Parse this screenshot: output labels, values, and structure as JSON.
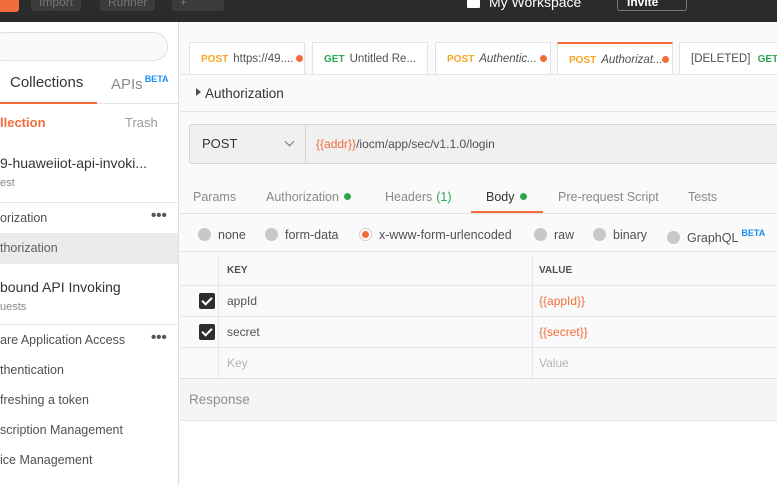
{
  "topbar": {
    "import_label": "Import",
    "runner_label": "Runner",
    "new_tab_label": "+",
    "workspace_label": "My Workspace",
    "invite_label": "Invite"
  },
  "sidebar": {
    "tabs": {
      "collections": "Collections",
      "apis": "APIs",
      "apis_badge": "BETA"
    },
    "new_collection_label": "llection",
    "trash_label": "Trash",
    "collections": [
      {
        "title": "9-huaweiiot-api-invoki...",
        "subtitle": "est"
      },
      {
        "title": "bound API Invoking",
        "subtitle": "uests"
      }
    ],
    "items": [
      {
        "label": "orization",
        "has_menu": true,
        "active": false
      },
      {
        "label": "thorization",
        "has_menu": false,
        "active": true
      },
      {
        "label": "are Application Access",
        "has_menu": true,
        "active": false
      },
      {
        "label": "thentication",
        "has_menu": false,
        "active": false
      },
      {
        "label": "freshing a token",
        "has_menu": false,
        "active": false
      },
      {
        "label": "scription Management",
        "has_menu": false,
        "active": false
      },
      {
        "label": "ice Management",
        "has_menu": false,
        "active": false
      }
    ]
  },
  "request_tabs": [
    {
      "method": "POST",
      "name": "https://49....",
      "unsaved": true,
      "active": false
    },
    {
      "method": "GET",
      "name": "Untitled Re...",
      "unsaved": false,
      "active": false
    },
    {
      "method": "POST",
      "name": "Authentic...",
      "unsaved": true,
      "active": false
    },
    {
      "method": "POST",
      "name": "Authorizat...",
      "unsaved": true,
      "active": true
    },
    {
      "method": "[DELETED]",
      "name": "GET",
      "unsaved": false,
      "active": false,
      "close": "×"
    }
  ],
  "request": {
    "title": "Authorization",
    "method": "POST",
    "url_var": "{{addr}}",
    "url_path": "/iocm/app/sec/v1.1.0/login"
  },
  "subtabs": {
    "params": "Params",
    "authorization": "Authorization",
    "headers": "Headers",
    "headers_count": "(1)",
    "body": "Body",
    "prerequest": "Pre-request Script",
    "tests": "Tests"
  },
  "body_types": {
    "none": "none",
    "form_data": "form-data",
    "urlencoded": "x-www-form-urlencoded",
    "raw": "raw",
    "binary": "binary",
    "graphql": "GraphQL",
    "graphql_badge": "BETA",
    "selected": "x-www-form-urlencoded"
  },
  "kv_table": {
    "key_header": "KEY",
    "value_header": "VALUE",
    "rows": [
      {
        "checked": true,
        "key": "appId",
        "value": "{{appId}}"
      },
      {
        "checked": true,
        "key": "secret",
        "value": "{{secret}}"
      }
    ],
    "key_placeholder": "Key",
    "value_placeholder": "Value"
  },
  "response": {
    "title": "Response"
  },
  "colors": {
    "accent": "#f26b3a",
    "post": "#f5a623",
    "get": "#2ca650",
    "beta": "#1a8ef5"
  }
}
